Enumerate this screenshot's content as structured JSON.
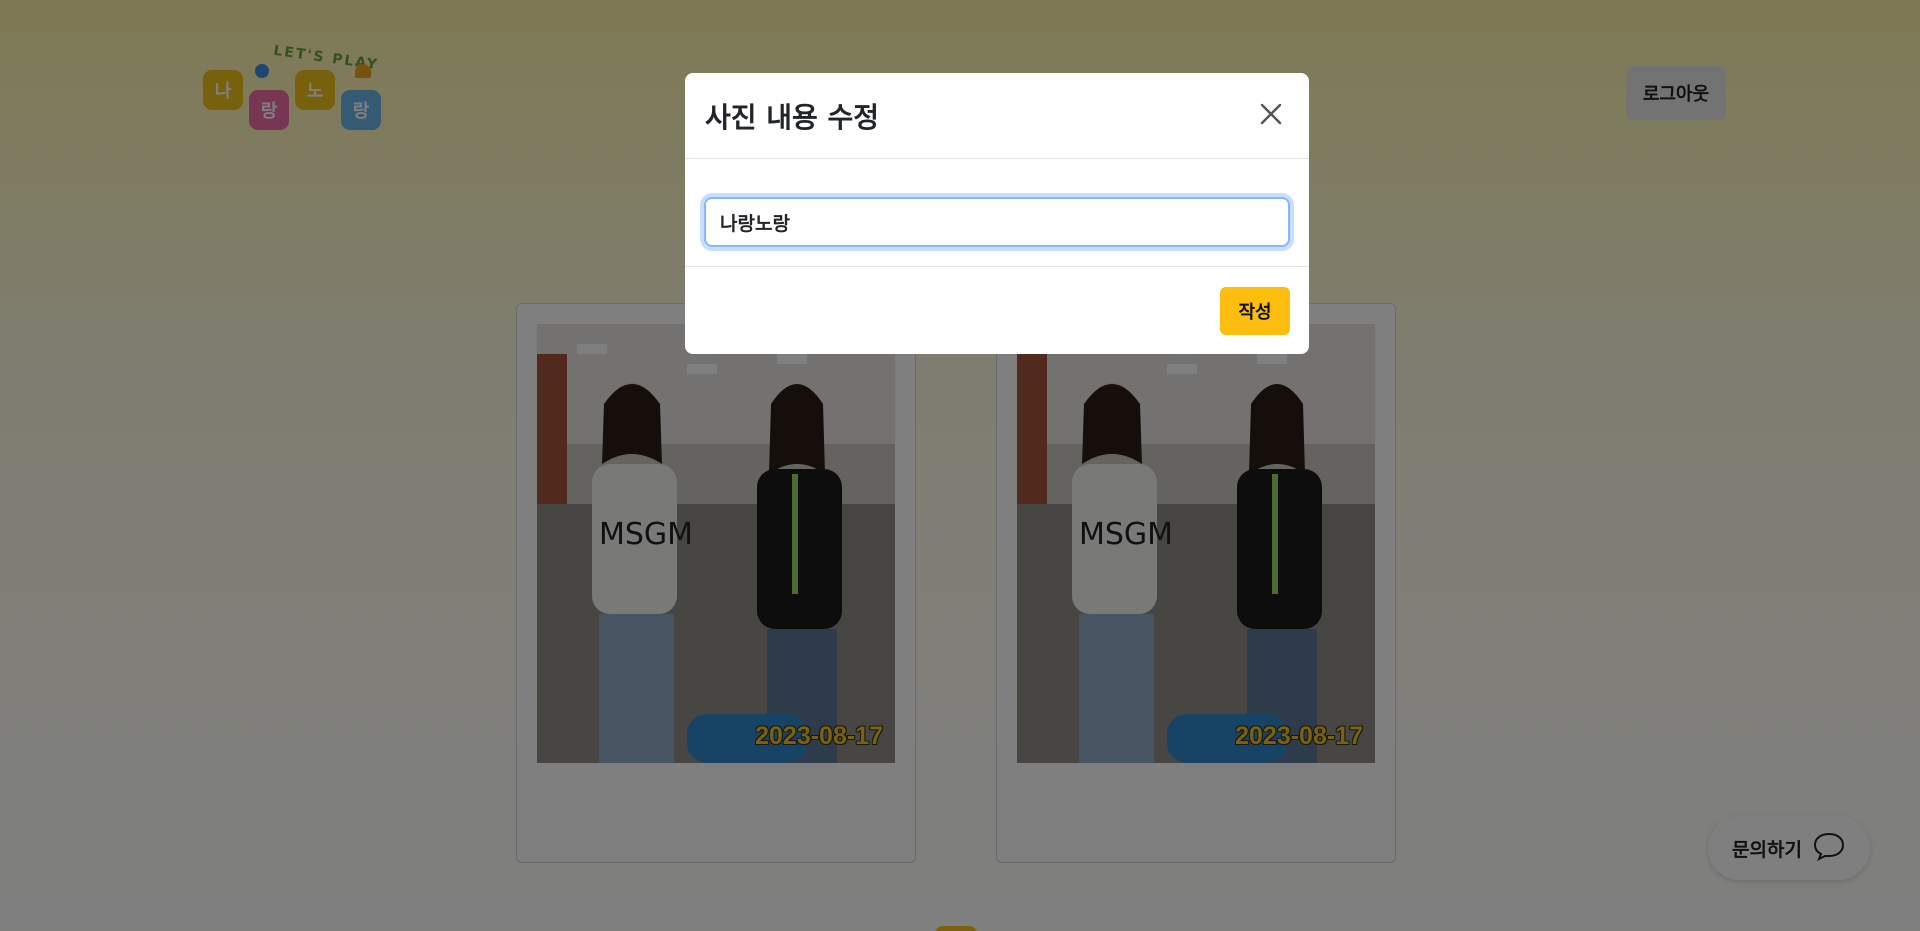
{
  "header": {
    "logo": {
      "tagline": "LET'S PLAY",
      "tiles": [
        "나",
        "랑",
        "노",
        "랑"
      ]
    },
    "logout_label": "로그아웃"
  },
  "photos": [
    {
      "date": "2023-08-17"
    },
    {
      "date": "2023-08-17"
    }
  ],
  "inquiry": {
    "label": "문의하기",
    "icon": "chat-bubble-icon"
  },
  "modal": {
    "title": "사진 내용 수정",
    "input_value": "나랑노랑",
    "submit_label": "작성",
    "close_icon": "close-icon"
  },
  "colors": {
    "accent": "#fcbd0f",
    "focus_ring": "#86b7fe",
    "date_text": "#f4c21a"
  }
}
